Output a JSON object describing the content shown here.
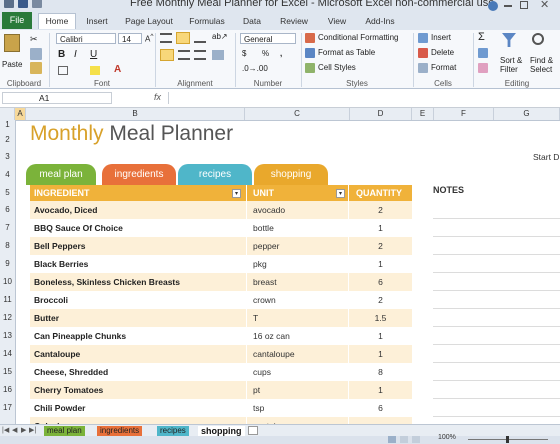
{
  "window": {
    "title": "Free Monthly Meal Planner for Excel - Microsoft Excel non-commercial use"
  },
  "ribbon": {
    "tabs": [
      "File",
      "Home",
      "Insert",
      "Page Layout",
      "Formulas",
      "Data",
      "Review",
      "View",
      "Add-Ins"
    ],
    "active_tab": "Home",
    "clipboard": {
      "paste": "Paste",
      "label": "Clipboard"
    },
    "font": {
      "name": "Calibri",
      "size": "14",
      "label": "Font"
    },
    "alignment": {
      "label": "Alignment"
    },
    "number": {
      "format": "General",
      "currency": "$",
      "percent": "%",
      "comma": ",",
      "label": "Number"
    },
    "styles": {
      "conditional": "Conditional Formatting",
      "table": "Format as Table",
      "cell": "Cell Styles",
      "label": "Styles"
    },
    "cells": {
      "insert": "Insert",
      "delete": "Delete",
      "format": "Format",
      "label": "Cells"
    },
    "editing": {
      "sigma": "Σ",
      "sort": "Sort &",
      "filter": "Filter",
      "find": "Find &",
      "select": "Select",
      "label": "Editing"
    }
  },
  "formula_bar": {
    "name_box": "A1",
    "fx": "fx",
    "value": ""
  },
  "columns": [
    "A",
    "B",
    "C",
    "D",
    "E",
    "F",
    "G"
  ],
  "rows": [
    "1",
    "2",
    "3",
    "4",
    "5",
    "6",
    "7",
    "8",
    "9",
    "10",
    "11",
    "12",
    "13",
    "14",
    "15",
    "16",
    "17"
  ],
  "planner": {
    "title_accent": "Monthly",
    "title_rest": "Meal Planner",
    "start_label": "Start D",
    "tabs": [
      {
        "label": "meal plan",
        "color": "#7bb33a"
      },
      {
        "label": "ingredients",
        "color": "#e8703a"
      },
      {
        "label": "recipes",
        "color": "#4fb6c9"
      },
      {
        "label": "shopping",
        "color": "#e9a82c"
      }
    ],
    "headers": {
      "ingredient": "INGREDIENT",
      "unit": "UNIT",
      "quantity": "QUANTITY"
    },
    "notes_label": "NOTES",
    "items": [
      {
        "ingredient": "Avocado, Diced",
        "unit": "avocado",
        "qty": "2"
      },
      {
        "ingredient": "BBQ Sauce Of Choice",
        "unit": "bottle",
        "qty": "1"
      },
      {
        "ingredient": "Bell Peppers",
        "unit": "pepper",
        "qty": "2"
      },
      {
        "ingredient": "Black Berries",
        "unit": "pkg",
        "qty": "1"
      },
      {
        "ingredient": "Boneless, Skinless Chicken Breasts",
        "unit": "breast",
        "qty": "6"
      },
      {
        "ingredient": "Broccoli",
        "unit": "crown",
        "qty": "2"
      },
      {
        "ingredient": "Butter",
        "unit": "T",
        "qty": "1.5"
      },
      {
        "ingredient": "Can Pineapple Chunks",
        "unit": "16 oz can",
        "qty": "1"
      },
      {
        "ingredient": "Cantaloupe",
        "unit": "cantaloupe",
        "qty": "1"
      },
      {
        "ingredient": "Cheese, Shredded",
        "unit": "cups",
        "qty": "8"
      },
      {
        "ingredient": "Cherry Tomatoes",
        "unit": "pt",
        "qty": "1"
      },
      {
        "ingredient": "Chili Powder",
        "unit": "tsp",
        "qty": "6"
      },
      {
        "ingredient": "Coleslaw",
        "unit": "container",
        "qty": ""
      }
    ]
  },
  "sheet_tabs": [
    {
      "label": "meal plan",
      "color": "#7bb33a"
    },
    {
      "label": "ingredients",
      "color": "#e8703a"
    },
    {
      "label": "recipes",
      "color": "#4fb6c9"
    },
    {
      "label": "shopping",
      "color": "#ffffff"
    }
  ],
  "active_sheet": "shopping",
  "status": {
    "zoom": "100%"
  },
  "colors": {
    "accent": "#f0b23a",
    "row_light": "#fdf0d8",
    "row_white": "#ffffff"
  }
}
